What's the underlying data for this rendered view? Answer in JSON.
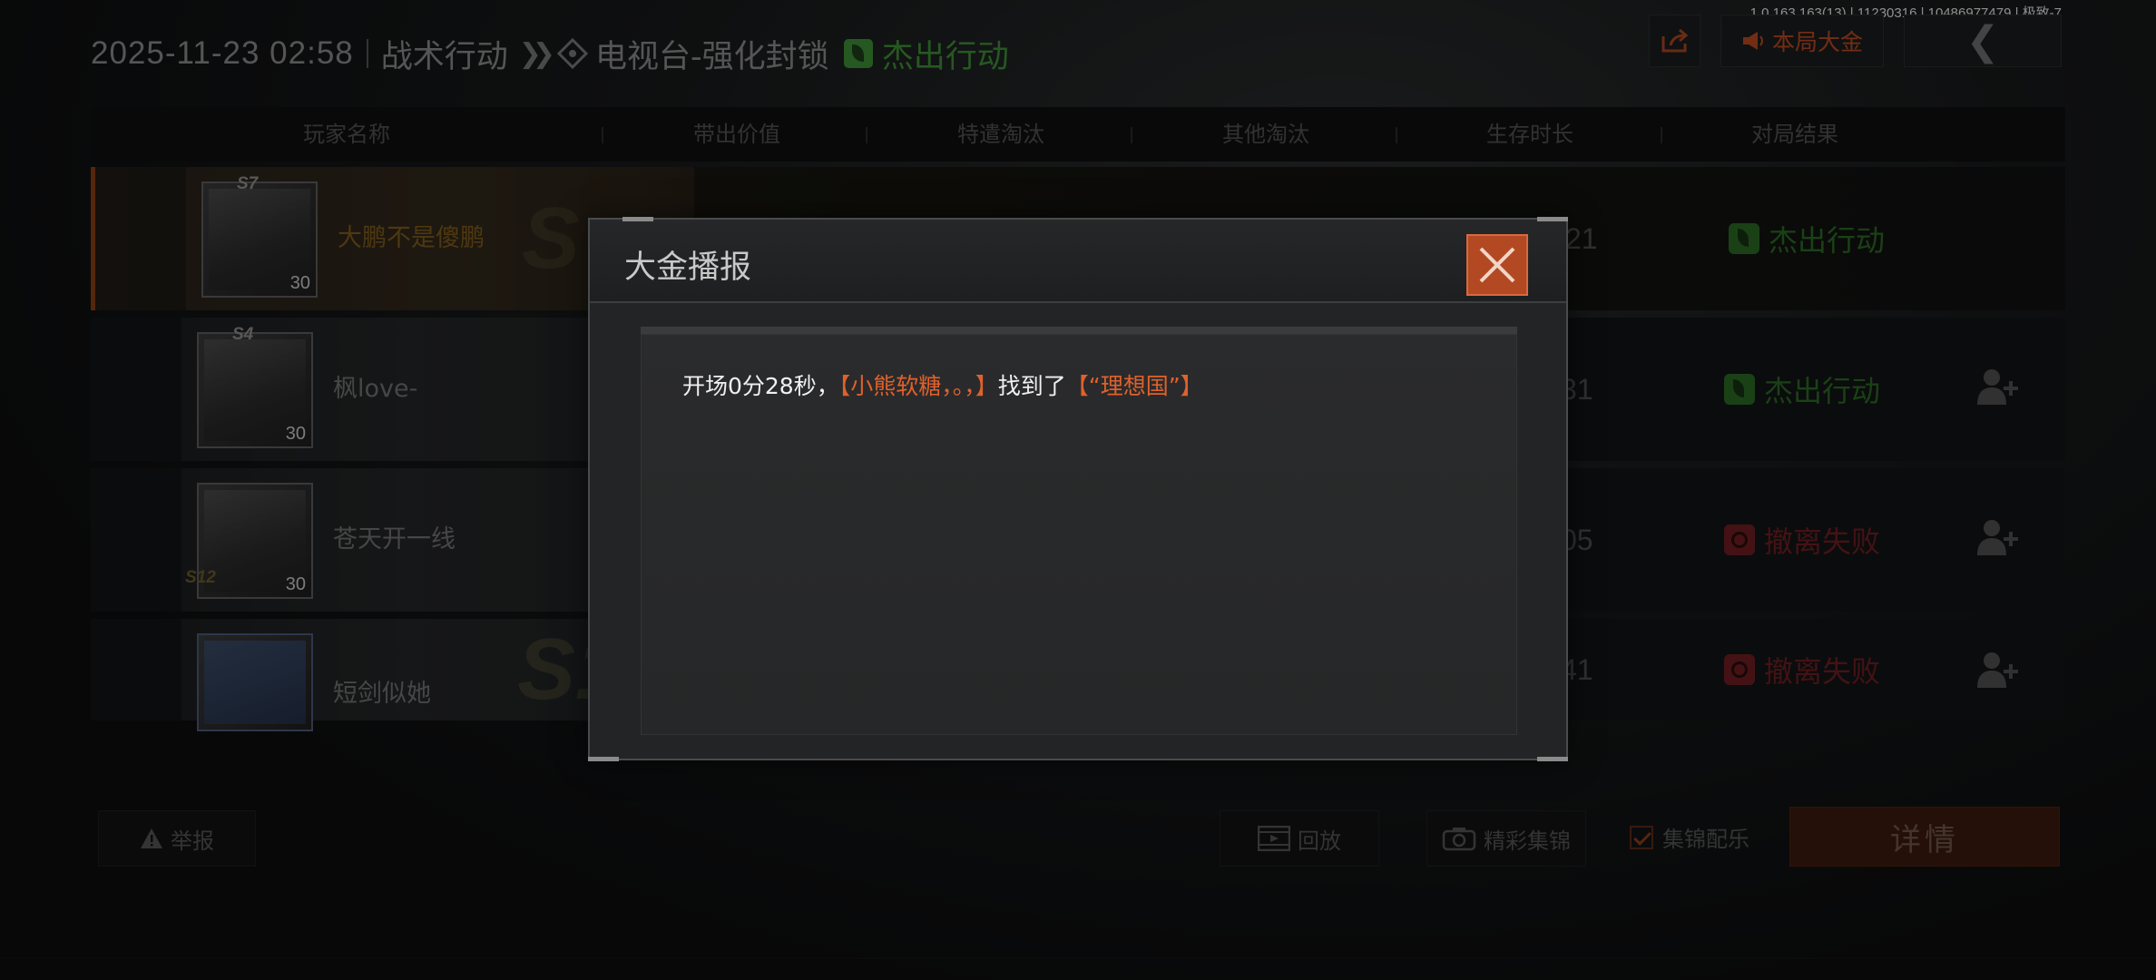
{
  "version_info": "1.0.163.163(13) | 11230316 | 10486977479 | 极致-7",
  "header": {
    "datetime": "2025-11-23 02:58",
    "mode": "战术行动",
    "map": "电视台-强化封锁",
    "result": "杰出行动",
    "bounty_button": "本局大金"
  },
  "table": {
    "columns": [
      "玩家名称",
      "带出价值",
      "特遣淘汰",
      "其他淘汰",
      "生存时长",
      "对局结果"
    ],
    "rows": [
      {
        "season": "S7",
        "name": "大鹏不是傻鹏",
        "level": "30",
        "time": "21",
        "result": "杰出行动",
        "result_type": "ok",
        "addable": false
      },
      {
        "season": "S4",
        "name": "枫love-",
        "level": "30",
        "time": "31",
        "result": "杰出行动",
        "result_type": "ok",
        "addable": true
      },
      {
        "season": "S12",
        "name": "苍天开一线",
        "level": "30",
        "time": "05",
        "result": "撤离失败",
        "result_type": "fail",
        "addable": true
      },
      {
        "season": "S1",
        "name": "短剑似她",
        "level": "",
        "time": "41",
        "result": "撤离失败",
        "result_type": "fail",
        "addable": true
      }
    ]
  },
  "bottom": {
    "report": "举报",
    "replay": "回放",
    "highlights": "精彩集锦",
    "music": "集锦配乐",
    "detail": "详情"
  },
  "modal": {
    "title": "大金播报",
    "msg_prefix": "开场0分28秒，",
    "msg_player": "【小熊软糖，。，】",
    "msg_mid": "找到了",
    "msg_item": "【“理想国”】"
  },
  "colors": {
    "accent": "#e0612b",
    "success": "#3e8e36",
    "fail": "#b8252c"
  }
}
